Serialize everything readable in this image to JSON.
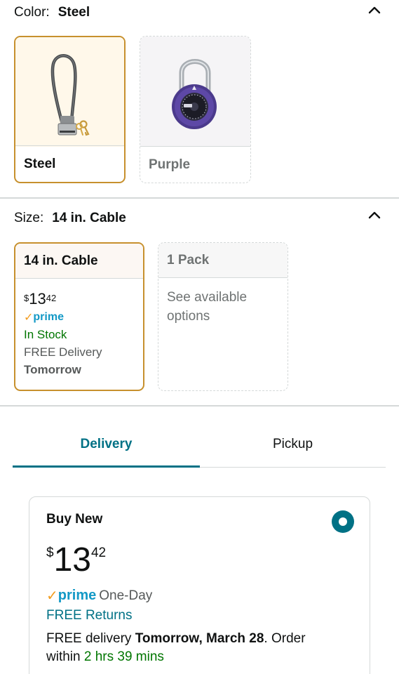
{
  "color_section": {
    "label": "Color:",
    "value": "Steel",
    "options": [
      {
        "name": "Steel",
        "selected": true
      },
      {
        "name": "Purple",
        "selected": false
      }
    ]
  },
  "size_section": {
    "label": "Size:",
    "value": "14 in. Cable",
    "options": [
      {
        "name": "14 in. Cable",
        "selected": true,
        "price_symbol": "$",
        "price_whole": "13",
        "price_fraction": "42",
        "prime": "prime",
        "stock": "In Stock",
        "delivery": "FREE Delivery",
        "delivery_day": "Tomorrow"
      },
      {
        "name": "1 Pack",
        "selected": false,
        "note": "See available options"
      }
    ]
  },
  "tabs": [
    {
      "label": "Delivery",
      "active": true
    },
    {
      "label": "Pickup",
      "active": false
    }
  ],
  "buy_box": {
    "title": "Buy New",
    "price_symbol": "$",
    "price_whole": "13",
    "price_fraction": "42",
    "prime": "prime",
    "prime_suffix": "One-Day",
    "returns": "FREE Returns",
    "delivery_prefix": "FREE delivery ",
    "delivery_date": "Tomorrow, March 28",
    "delivery_mid": ". Order",
    "order_within_prefix": "within ",
    "order_within": "2 hrs 39 mins"
  },
  "colors": {
    "selected_border": "#c7902d",
    "teal": "#007185",
    "prime_blue": "#1399c6",
    "prime_check": "#f29c1f",
    "stock_green": "#007600"
  },
  "icons": [
    "chevron-up-icon",
    "cable-lock-image",
    "padlock-image",
    "prime-check-icon",
    "radio-selected-icon"
  ]
}
